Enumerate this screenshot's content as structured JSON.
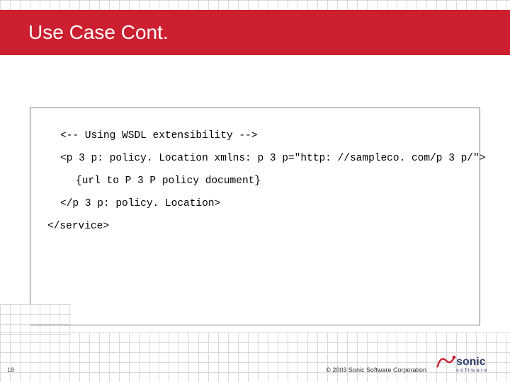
{
  "title": "Use Case Cont.",
  "code": {
    "l1": "<-- Using WSDL extensibility -->",
    "l2": "<p 3 p: policy. Location xmlns: p 3 p=\"http: //sampleco. com/p 3 p/\">",
    "l3": "{url to P 3 P policy document}",
    "l4": "</p 3 p: policy. Location>",
    "l5": "</service>"
  },
  "page_number": "18",
  "copyright": "© 2003 Sonic Software Corporation",
  "logo": {
    "brand_text": "sonic",
    "sub_text": "software",
    "accent_color": "#cc1f2f",
    "text_color": "#2a3a66"
  }
}
